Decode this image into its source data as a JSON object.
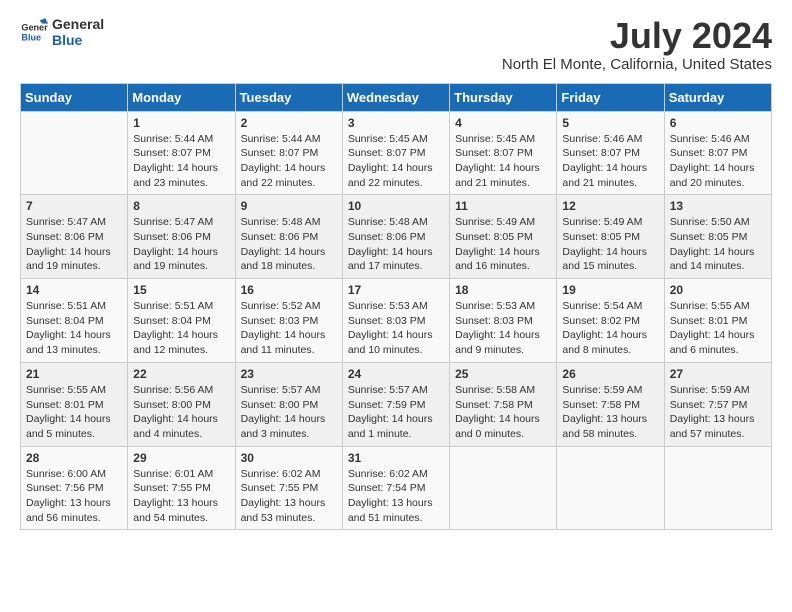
{
  "logo": {
    "name": "GeneralBlue",
    "line1": "General",
    "line2": "Blue"
  },
  "title": "July 2024",
  "subtitle": "North El Monte, California, United States",
  "weekdays": [
    "Sunday",
    "Monday",
    "Tuesday",
    "Wednesday",
    "Thursday",
    "Friday",
    "Saturday"
  ],
  "weeks": [
    [
      {
        "day": "",
        "info": ""
      },
      {
        "day": "1",
        "info": "Sunrise: 5:44 AM\nSunset: 8:07 PM\nDaylight: 14 hours\nand 23 minutes."
      },
      {
        "day": "2",
        "info": "Sunrise: 5:44 AM\nSunset: 8:07 PM\nDaylight: 14 hours\nand 22 minutes."
      },
      {
        "day": "3",
        "info": "Sunrise: 5:45 AM\nSunset: 8:07 PM\nDaylight: 14 hours\nand 22 minutes."
      },
      {
        "day": "4",
        "info": "Sunrise: 5:45 AM\nSunset: 8:07 PM\nDaylight: 14 hours\nand 21 minutes."
      },
      {
        "day": "5",
        "info": "Sunrise: 5:46 AM\nSunset: 8:07 PM\nDaylight: 14 hours\nand 21 minutes."
      },
      {
        "day": "6",
        "info": "Sunrise: 5:46 AM\nSunset: 8:07 PM\nDaylight: 14 hours\nand 20 minutes."
      }
    ],
    [
      {
        "day": "7",
        "info": "Sunrise: 5:47 AM\nSunset: 8:06 PM\nDaylight: 14 hours\nand 19 minutes."
      },
      {
        "day": "8",
        "info": "Sunrise: 5:47 AM\nSunset: 8:06 PM\nDaylight: 14 hours\nand 19 minutes."
      },
      {
        "day": "9",
        "info": "Sunrise: 5:48 AM\nSunset: 8:06 PM\nDaylight: 14 hours\nand 18 minutes."
      },
      {
        "day": "10",
        "info": "Sunrise: 5:48 AM\nSunset: 8:06 PM\nDaylight: 14 hours\nand 17 minutes."
      },
      {
        "day": "11",
        "info": "Sunrise: 5:49 AM\nSunset: 8:05 PM\nDaylight: 14 hours\nand 16 minutes."
      },
      {
        "day": "12",
        "info": "Sunrise: 5:49 AM\nSunset: 8:05 PM\nDaylight: 14 hours\nand 15 minutes."
      },
      {
        "day": "13",
        "info": "Sunrise: 5:50 AM\nSunset: 8:05 PM\nDaylight: 14 hours\nand 14 minutes."
      }
    ],
    [
      {
        "day": "14",
        "info": "Sunrise: 5:51 AM\nSunset: 8:04 PM\nDaylight: 14 hours\nand 13 minutes."
      },
      {
        "day": "15",
        "info": "Sunrise: 5:51 AM\nSunset: 8:04 PM\nDaylight: 14 hours\nand 12 minutes."
      },
      {
        "day": "16",
        "info": "Sunrise: 5:52 AM\nSunset: 8:03 PM\nDaylight: 14 hours\nand 11 minutes."
      },
      {
        "day": "17",
        "info": "Sunrise: 5:53 AM\nSunset: 8:03 PM\nDaylight: 14 hours\nand 10 minutes."
      },
      {
        "day": "18",
        "info": "Sunrise: 5:53 AM\nSunset: 8:03 PM\nDaylight: 14 hours\nand 9 minutes."
      },
      {
        "day": "19",
        "info": "Sunrise: 5:54 AM\nSunset: 8:02 PM\nDaylight: 14 hours\nand 8 minutes."
      },
      {
        "day": "20",
        "info": "Sunrise: 5:55 AM\nSunset: 8:01 PM\nDaylight: 14 hours\nand 6 minutes."
      }
    ],
    [
      {
        "day": "21",
        "info": "Sunrise: 5:55 AM\nSunset: 8:01 PM\nDaylight: 14 hours\nand 5 minutes."
      },
      {
        "day": "22",
        "info": "Sunrise: 5:56 AM\nSunset: 8:00 PM\nDaylight: 14 hours\nand 4 minutes."
      },
      {
        "day": "23",
        "info": "Sunrise: 5:57 AM\nSunset: 8:00 PM\nDaylight: 14 hours\nand 3 minutes."
      },
      {
        "day": "24",
        "info": "Sunrise: 5:57 AM\nSunset: 7:59 PM\nDaylight: 14 hours\nand 1 minute."
      },
      {
        "day": "25",
        "info": "Sunrise: 5:58 AM\nSunset: 7:58 PM\nDaylight: 14 hours\nand 0 minutes."
      },
      {
        "day": "26",
        "info": "Sunrise: 5:59 AM\nSunset: 7:58 PM\nDaylight: 13 hours\nand 58 minutes."
      },
      {
        "day": "27",
        "info": "Sunrise: 5:59 AM\nSunset: 7:57 PM\nDaylight: 13 hours\nand 57 minutes."
      }
    ],
    [
      {
        "day": "28",
        "info": "Sunrise: 6:00 AM\nSunset: 7:56 PM\nDaylight: 13 hours\nand 56 minutes."
      },
      {
        "day": "29",
        "info": "Sunrise: 6:01 AM\nSunset: 7:55 PM\nDaylight: 13 hours\nand 54 minutes."
      },
      {
        "day": "30",
        "info": "Sunrise: 6:02 AM\nSunset: 7:55 PM\nDaylight: 13 hours\nand 53 minutes."
      },
      {
        "day": "31",
        "info": "Sunrise: 6:02 AM\nSunset: 7:54 PM\nDaylight: 13 hours\nand 51 minutes."
      },
      {
        "day": "",
        "info": ""
      },
      {
        "day": "",
        "info": ""
      },
      {
        "day": "",
        "info": ""
      }
    ]
  ]
}
